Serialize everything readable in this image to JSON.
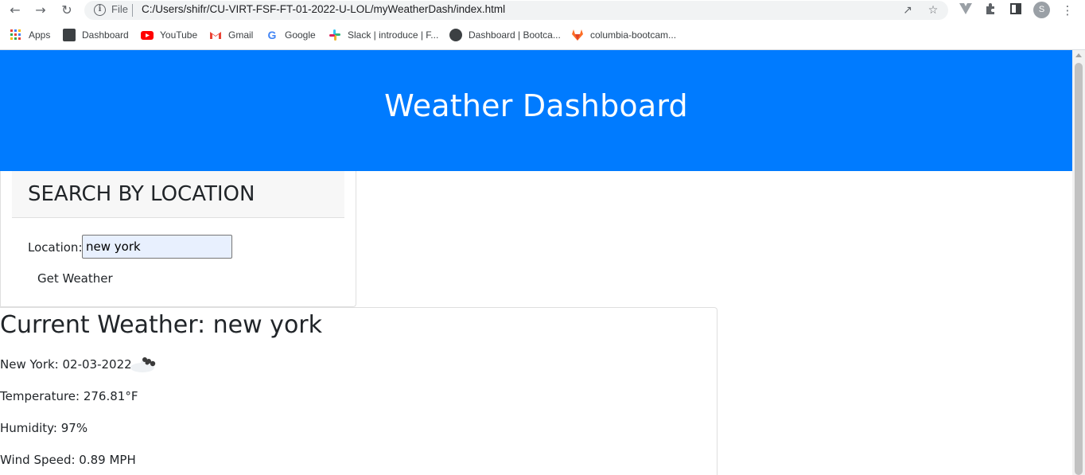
{
  "browser": {
    "file_label": "File",
    "url": "C:/Users/shifr/CU-VIRT-FSF-FT-01-2022-U-LOL/myWeatherDash/index.html",
    "avatar_letter": "S",
    "icons": [
      "back-icon",
      "forward-icon",
      "reload-icon",
      "info-icon",
      "share-icon",
      "star-icon",
      "vue-devtools-icon",
      "extensions-icon",
      "side-panel-icon",
      "menu-icon"
    ]
  },
  "bookmarks": [
    {
      "label": "Apps",
      "icon": "apps-grid-icon",
      "color": "#ea4335"
    },
    {
      "label": "Dashboard",
      "icon": "dashboard-favicon",
      "color": "#3c4043"
    },
    {
      "label": "YouTube",
      "icon": "youtube-icon",
      "color": "#ff0000"
    },
    {
      "label": "Gmail",
      "icon": "gmail-icon",
      "color": "#ea4335"
    },
    {
      "label": "Google",
      "icon": "google-icon",
      "color": "#4285f4"
    },
    {
      "label": "Slack | introduce | F...",
      "icon": "slack-icon",
      "color": "#e01e5a"
    },
    {
      "label": "Dashboard | Bootca...",
      "icon": "globe-icon",
      "color": "#5f6368"
    },
    {
      "label": "columbia-bootcam...",
      "icon": "gitlab-icon",
      "color": "#fc6d26"
    }
  ],
  "header": {
    "title": "Weather Dashboard",
    "bg_color": "#007bff"
  },
  "search": {
    "title": "SEARCH BY LOCATION",
    "location_label": "Location:",
    "location_value": "new york",
    "button_label": "Get Weather"
  },
  "current": {
    "title": "Current Weather: new york",
    "date_line": "New York: 02-03-2022",
    "weather_icon": "cloud-icon",
    "temperature": "Temperature: 276.81°F",
    "humidity": "Humidity: 97%",
    "wind": "Wind Speed: 0.89 MPH"
  }
}
